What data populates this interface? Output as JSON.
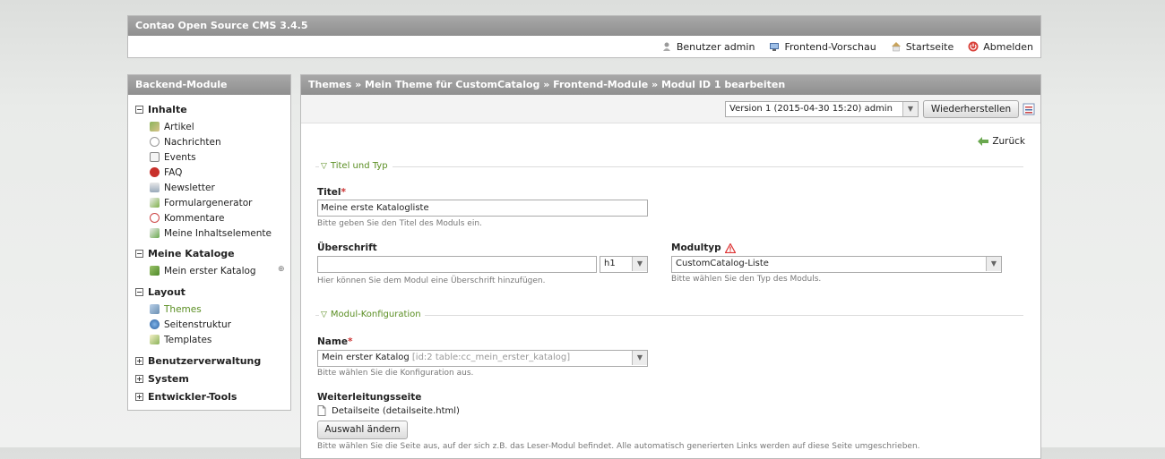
{
  "header": {
    "title": "Contao Open Source CMS 3.4.5",
    "toolbar": {
      "user": "Benutzer admin",
      "preview": "Frontend-Vorschau",
      "home": "Startseite",
      "logout": "Abmelden"
    }
  },
  "sidebar": {
    "title": "Backend-Module",
    "groups": [
      {
        "label": "Inhalte",
        "toggle": "−",
        "items": [
          {
            "label": "Artikel",
            "icon": "article-icon"
          },
          {
            "label": "Nachrichten",
            "icon": "news-icon"
          },
          {
            "label": "Events",
            "icon": "events-icon"
          },
          {
            "label": "FAQ",
            "icon": "faq-icon"
          },
          {
            "label": "Newsletter",
            "icon": "newsletter-icon"
          },
          {
            "label": "Formulargenerator",
            "icon": "form-icon"
          },
          {
            "label": "Kommentare",
            "icon": "comments-icon"
          },
          {
            "label": "Meine Inhaltselemente",
            "icon": "elements-icon"
          }
        ]
      },
      {
        "label": "Meine Kataloge",
        "toggle": "−",
        "items": [
          {
            "label": "Mein erster Katalog",
            "icon": "catalog-icon"
          }
        ]
      },
      {
        "label": "Layout",
        "toggle": "−",
        "items": [
          {
            "label": "Themes",
            "icon": "themes-icon"
          },
          {
            "label": "Seitenstruktur",
            "icon": "sitestructure-icon"
          },
          {
            "label": "Templates",
            "icon": "templates-icon"
          }
        ]
      },
      {
        "label": "Benutzerverwaltung",
        "toggle": "+"
      },
      {
        "label": "System",
        "toggle": "+"
      },
      {
        "label": "Entwickler-Tools",
        "toggle": "+"
      }
    ]
  },
  "main": {
    "breadcrumb": "Themes » Mein Theme für CustomCatalog » Frontend-Module » Modul ID 1 bearbeiten",
    "version_select": "Version 1 (2015-04-30 15:20) admin",
    "restore_button": "Wiederherstellen",
    "back_link": "Zurück",
    "fieldset1": "Titel und Typ",
    "title_label": "Titel",
    "title_value": "Meine erste Katalogliste",
    "title_help": "Bitte geben Sie den Titel des Moduls ein.",
    "headline_label": "Überschrift",
    "headline_value": "",
    "headline_unit": "h1",
    "headline_help": "Hier können Sie dem Modul eine Überschrift hinzufügen.",
    "type_label": "Modultyp",
    "type_value": "CustomCatalog-Liste",
    "type_help": "Bitte wählen Sie den Typ des Moduls.",
    "fieldset2": "Modul-Konfiguration",
    "name_label": "Name",
    "name_value": "Mein erster Katalog",
    "name_value_extra": "[id:2 table:cc_mein_erster_katalog]",
    "name_help": "Bitte wählen Sie die Konfiguration aus.",
    "redirect_label": "Weiterleitungsseite",
    "redirect_value": "Detailseite (detailseite.html)",
    "redirect_button": "Auswahl ändern",
    "redirect_help": "Bitte wählen Sie die Seite aus, auf der sich z.B. das Leser-Modul befindet. Alle automatisch generierten Links werden auf diese Seite umgeschrieben."
  },
  "colors": {
    "accent_green": "#5a8e22",
    "title_bar_gray": "#999999",
    "required_red": "#cc3333"
  }
}
